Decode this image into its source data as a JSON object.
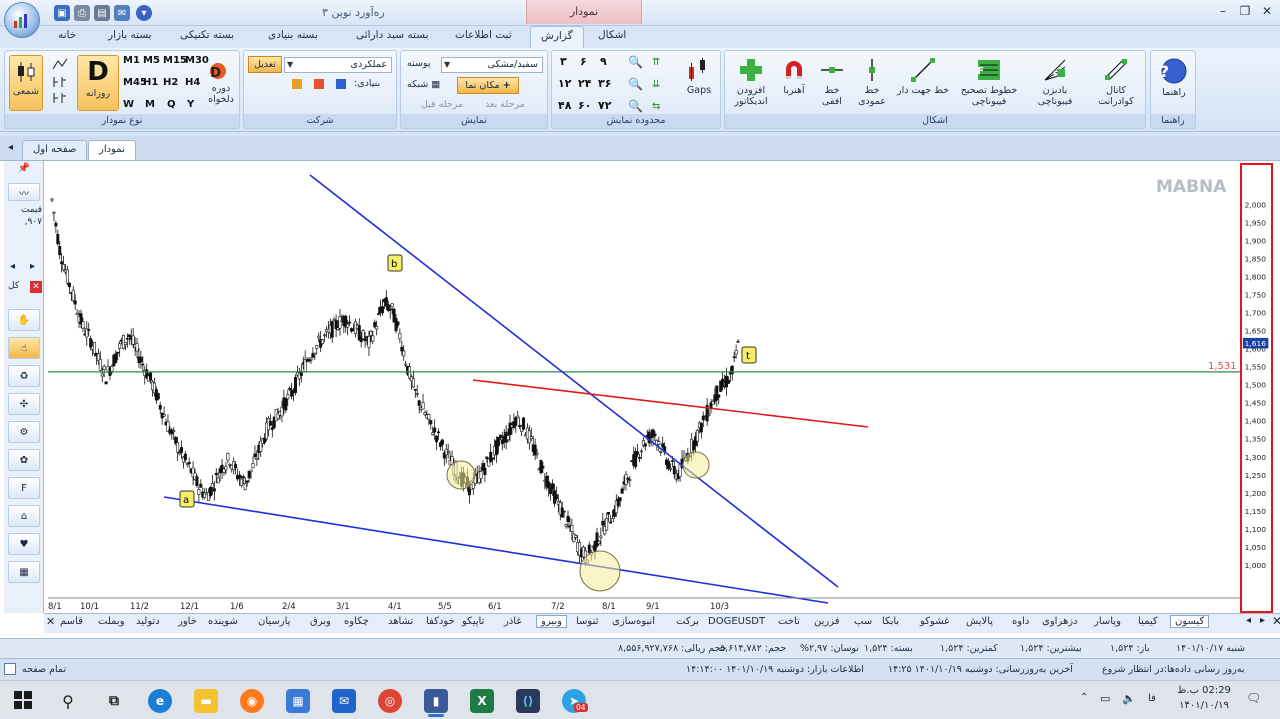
{
  "titlebar": {
    "window_title": "ره‌آورد نوین ۳",
    "context_tab_title": "نمودار"
  },
  "ribbon_tabs": [
    "خانه",
    "بسته بازار",
    "بسته تکنیکی",
    "بسته بنیادی",
    "بسته سبد دارائی",
    "ثبت اطلاعات",
    "گزارش",
    "اشکال"
  ],
  "ribbon": {
    "chart_type": {
      "label": "نوع نمودار",
      "candle": "شمعی",
      "daily_letter": "D",
      "daily": "روزانه",
      "custom_period": "دوره دلخواه",
      "periods_row1": [
        "M1",
        "M5",
        "M15",
        "M30"
      ],
      "periods_row2": [
        "M45",
        "H1",
        "H2",
        "H4"
      ],
      "periods_row3": [
        "W",
        "M",
        "Q",
        "Y"
      ]
    },
    "company": {
      "label": "شرکت",
      "combo_value": "عملکردی",
      "adjust": "تعدیل",
      "fundamental": "بنیادی:"
    },
    "display": {
      "label": "نمایش",
      "skin_label": "پوسته",
      "skin_value": "سفید/مشکی",
      "grid": "شبکه",
      "cursor": "مکان نما",
      "next_step": "مرحله بعد",
      "prev_step": "مرحله قبل"
    },
    "range": {
      "label": "محدوده نمایش",
      "row1": [
        "۳",
        "۶",
        "۹"
      ],
      "row2": [
        "۱۲",
        "۲۴",
        "۳۶"
      ],
      "row3": [
        "۴۸",
        "۶۰",
        "۷۲"
      ],
      "gaps": "Gaps"
    },
    "shapes": {
      "label": "اشکال",
      "add_indicator": "افزودن اندیکاتور",
      "magnet": "آهنربا",
      "horizontal": "خط افقی",
      "vertical": "خط عمودی",
      "trend": "خط جهت دار",
      "fib_retrace": "خطوط تصحیح فیبوناچی",
      "fib_fan": "بادبزن فیبوناچی",
      "quadrant": "کانال کوادرانت"
    },
    "help": {
      "label": "راهنما",
      "button": "راهنما"
    }
  },
  "doc_tabs": [
    "صفحه اول",
    "نمودار"
  ],
  "left_toolbar": {
    "price_label": "قیمت",
    "price_value": "۹۰۷,",
    "all_label": "کل"
  },
  "chart": {
    "watermark": "MABNA",
    "hline_label": "1,531",
    "last_price": "1,616",
    "annotations": [
      "a",
      "b",
      "t"
    ],
    "xaxis": [
      "8/1",
      "10/1",
      "11/2",
      "12/1",
      "1/6",
      "2/4",
      "3/1",
      "4/1",
      "5/5",
      "6/1",
      "7/2",
      "8/1",
      "9/1",
      "10/3"
    ]
  },
  "chart_data": {
    "type": "candlestick",
    "ylim": [
      980,
      2040
    ],
    "yticks": [
      2000,
      1950,
      1900,
      1850,
      1800,
      1750,
      1700,
      1650,
      1600,
      1550,
      1500,
      1450,
      1400,
      1350,
      1300,
      1250,
      1200,
      1150,
      1100,
      1050,
      1000
    ],
    "ytick_labels": [
      "2,000",
      "1,950",
      "1,900",
      "1,850",
      "1,800",
      "1,750",
      "1,700",
      "1,650",
      "1,600",
      "1,550",
      "1,500",
      "1,450",
      "1,400",
      "1,350",
      "1,300",
      "1,250",
      "1,200",
      "1,150",
      "1,100",
      "1,050",
      "1,000"
    ],
    "xticks": [
      "8/1",
      "10/1",
      "11/2",
      "12/1",
      "1/6",
      "2/4",
      "3/1",
      "4/1",
      "5/5",
      "6/1",
      "7/2",
      "8/1",
      "9/1",
      "10/3"
    ],
    "closes": [
      1950,
      1830,
      1760,
      1700,
      1640,
      1610,
      1560,
      1520,
      1560,
      1600,
      1620,
      1580,
      1540,
      1500,
      1450,
      1400,
      1360,
      1320,
      1290,
      1250,
      1230,
      1260,
      1300,
      1320,
      1280,
      1260,
      1300,
      1350,
      1400,
      1420,
      1450,
      1480,
      1520,
      1560,
      1590,
      1610,
      1630,
      1650,
      1660,
      1640,
      1620,
      1600,
      1650,
      1700,
      1680,
      1620,
      1540,
      1480,
      1440,
      1400,
      1370,
      1330,
      1300,
      1270,
      1250,
      1270,
      1300,
      1330,
      1360,
      1380,
      1420,
      1400,
      1360,
      1310,
      1270,
      1230,
      1190,
      1150,
      1110,
      1080,
      1100,
      1140,
      1170,
      1200,
      1250,
      1300,
      1340,
      1370,
      1380,
      1340,
      1300,
      1280,
      1320,
      1360,
      1400,
      1440,
      1480,
      1500,
      1530,
      1616
    ],
    "horizontal_line": 1531,
    "last_price": 1616
  },
  "symbols": [
    "کیسون",
    "کیمیا",
    "وپاسار",
    "دزهراوی",
    "داوه",
    "پالایش",
    "غشوکو",
    "بابکا",
    "سپ",
    "فزرین",
    "تاخت",
    "DOGEUSDT",
    "برکت",
    "انبوه‌سازی",
    "ثنوسا",
    "وبیرو",
    "غاذر",
    "تاپیکو",
    "خودکفا",
    "تشاهد",
    "چکاوه",
    "وبرق",
    "پارسیان",
    "شوینده",
    "خاور",
    "دتولید",
    "وبملت",
    "قاسم"
  ],
  "status1": [
    "شنبه ۱۴۰۱/۱۰/۱۷",
    "باز: ۱,۵۲۴",
    "بیشترین: ۱,۵۲۴",
    "کمترین: ۱,۵۲۴",
    "بسته: ۱,۵۲۴",
    "نوسان: ۲,۹۷%",
    "حجم: ۵,۶۱۴,۷۸۲",
    "حجم ریالی: ۸,۵۵۶,۹۲۷,۷۶۸"
  ],
  "status2": [
    "تمام صفحه",
    "به‌روز رسانی داده‌ها:در انتظار شروع",
    "آخرین به‌روزرسانی: دوشنبه ۱۴۰۱/۱۰/۱۹ ۱۴:۲۵",
    "اطلاعات بازار: دوشنبه ۱۴۰۱/۱۰/۱۹ ۱۴:۱۴:۰۰"
  ],
  "taskbar": {
    "time": "02:29 ب.ظ",
    "date": "۱۴۰۱/۱۰/۱۹",
    "lang": "فا",
    "badge": "04"
  },
  "colors": {
    "hline": "#2e8b57",
    "trend_blue": "#1d2fd8",
    "trend_red": "#e01b1b",
    "marker_fill": "#f5ec9a",
    "annotation": "#f7f066",
    "last_price_bg": "#1b3fa8"
  }
}
